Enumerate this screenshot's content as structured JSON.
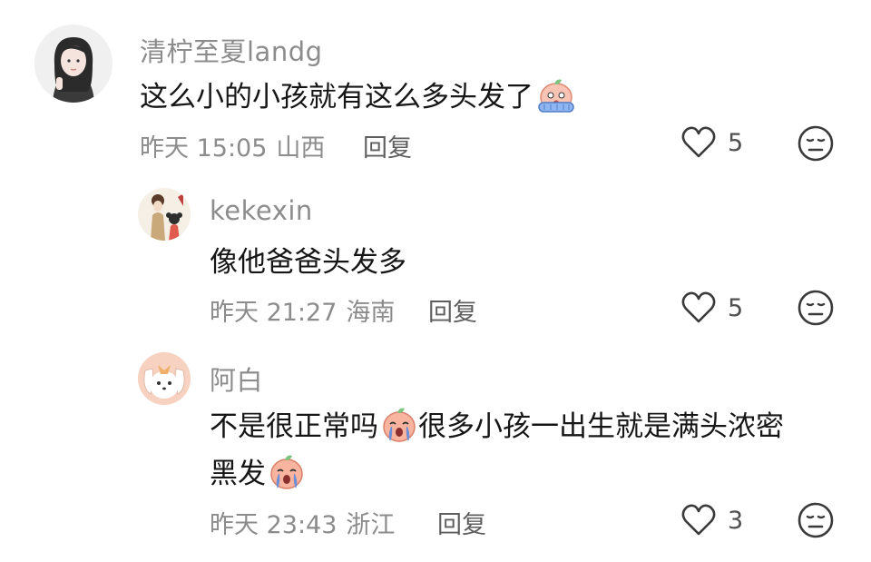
{
  "comments": [
    {
      "username": "清柠至夏landg",
      "text": "这么小的小孩就有这么多头发了",
      "emoji": "peach-scared-emoji",
      "time": "昨天 15:05",
      "location": "山西",
      "reply_label": "回复",
      "likes": "5"
    },
    {
      "username": "kekexin",
      "text": "像他爸爸头发多",
      "time": "昨天 21:27",
      "location": "海南",
      "reply_label": "回复",
      "likes": "5"
    },
    {
      "username": "阿白",
      "text_line1": "不是很正常吗",
      "text_line1_after": "很多小孩一出生就是满头浓密",
      "text_line2": "黑发",
      "emoji": "peach-crying-emoji",
      "time": "昨天 23:43",
      "location": "浙江",
      "reply_label": "回复",
      "likes": "3"
    }
  ],
  "icons": {
    "like": "heart-outline-icon",
    "dislike": "neutral-face-icon"
  },
  "colors": {
    "meta_gray": "#8c8c8c",
    "text": "#161616",
    "peach": "#f4a48e",
    "tear_blue": "#6b8ed6"
  }
}
